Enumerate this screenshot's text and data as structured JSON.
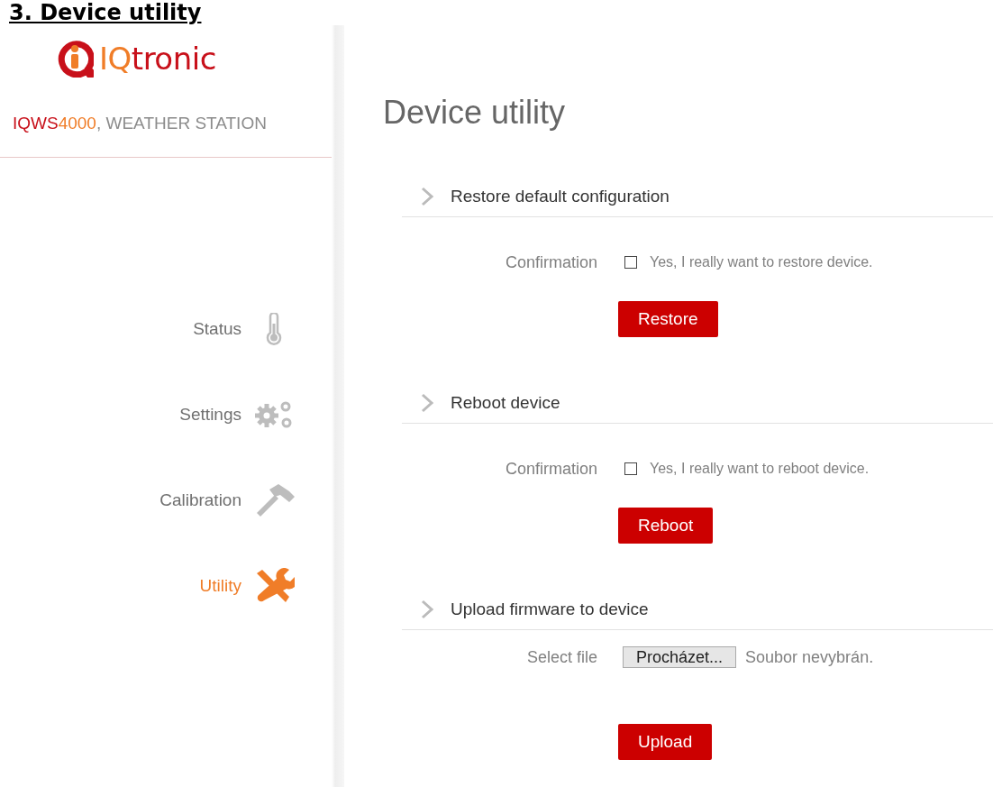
{
  "heading": "3. Device utility",
  "logo": {
    "parts": [
      {
        "text": "IQ",
        "color": "#f07d28"
      },
      {
        "text": "tronic",
        "color": "#c8101a"
      }
    ]
  },
  "device": {
    "parts": [
      {
        "text": "IQWS",
        "color": "#c8101a"
      },
      {
        "text": "4000",
        "color": "#f07d28"
      },
      {
        "text": ", WEATHER STATION",
        "color": "#8c8c8c"
      }
    ]
  },
  "nav": [
    {
      "label": "Status",
      "kind": "thermometer",
      "selected": false
    },
    {
      "label": "Settings",
      "kind": "gears",
      "selected": false
    },
    {
      "label": "Calibration",
      "kind": "hammer",
      "selected": false
    },
    {
      "label": "Utility",
      "kind": "tools",
      "selected": true
    }
  ],
  "title": "Device utility",
  "sections": [
    {
      "title": "Restore default configuration",
      "kind": "confirm",
      "label": "Confirmation",
      "checked": false,
      "checkbox_label": "Yes, I really want to restore device.",
      "button": "Restore"
    },
    {
      "title": "Reboot device",
      "kind": "confirm",
      "label": "Confirmation",
      "checked": false,
      "checkbox_label": "Yes, I really want to reboot device.",
      "button": "Reboot"
    },
    {
      "title": "Upload firmware to device",
      "kind": "file",
      "label": "Select file",
      "browse": "Procházet...",
      "file_status": "Soubor nevybrán.",
      "button": "Upload"
    }
  ]
}
